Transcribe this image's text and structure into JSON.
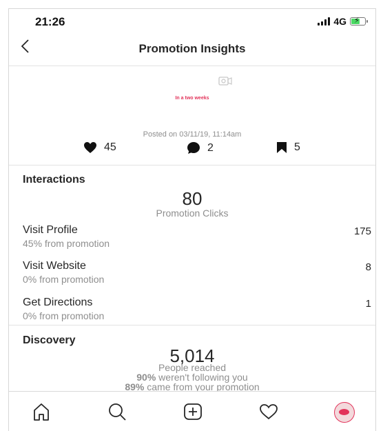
{
  "status_bar": {
    "time": "21:26",
    "network": "4G"
  },
  "header": {
    "title": "Promotion Insights"
  },
  "post": {
    "caption": "In a two weeks",
    "posted_on": "Posted on 03/11/19, 11:14am",
    "likes": "45",
    "comments": "2",
    "saves": "5"
  },
  "interactions": {
    "heading": "Interactions",
    "clicks_value": "80",
    "clicks_label": "Promotion Clicks",
    "rows": [
      {
        "title": "Visit Profile",
        "sub": "45% from promotion",
        "value": "175"
      },
      {
        "title": "Visit Website",
        "sub": "0% from promotion",
        "value": "8"
      },
      {
        "title": "Get Directions",
        "sub": "0% from promotion",
        "value": "1"
      }
    ]
  },
  "discovery": {
    "heading": "Discovery",
    "reached_value": "5,014",
    "reached_label": "People reached",
    "not_following_pct": "90%",
    "not_following_text": " weren't following you",
    "from_promo_pct": "89%",
    "from_promo_text": " came from your promotion"
  },
  "tab_bar": {
    "icons": [
      "home-icon",
      "search-icon",
      "add-post-icon",
      "activity-heart-icon",
      "profile-avatar"
    ]
  },
  "colors": {
    "accent": "#e2335a",
    "text": "#262626",
    "muted": "#8e8e8e"
  }
}
